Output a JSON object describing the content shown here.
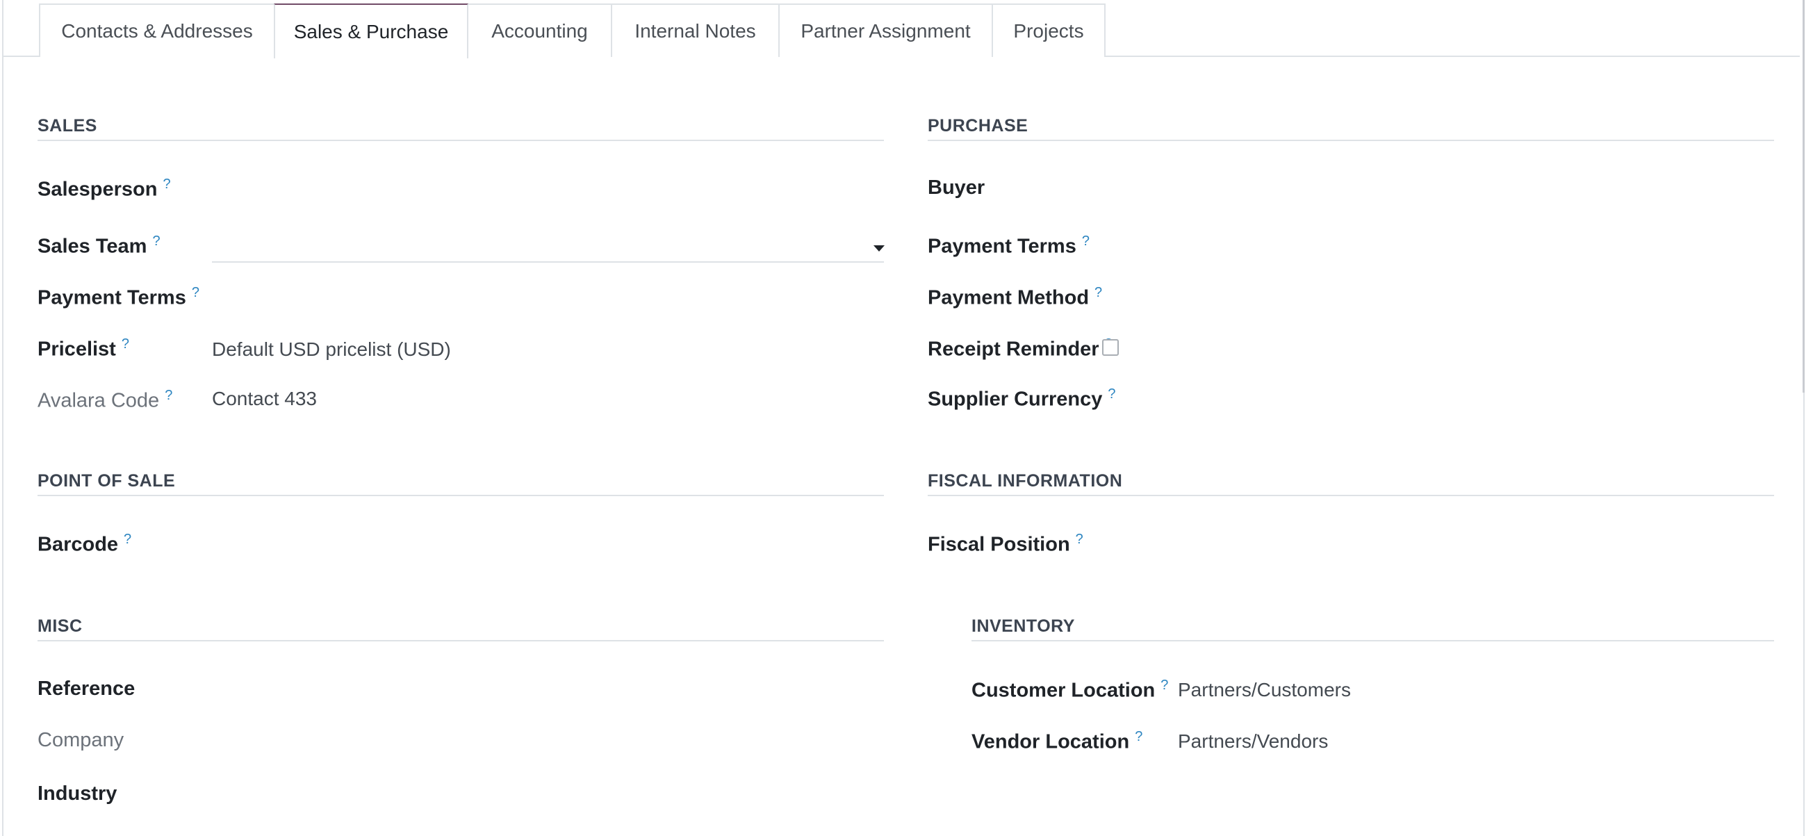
{
  "tabs": [
    {
      "label": "Contacts & Addresses"
    },
    {
      "label": "Sales & Purchase"
    },
    {
      "label": "Accounting"
    },
    {
      "label": "Internal Notes"
    },
    {
      "label": "Partner Assignment"
    },
    {
      "label": "Projects"
    }
  ],
  "active_tab": "Sales & Purchase",
  "help_mark": "?",
  "sales": {
    "title": "SALES",
    "salesperson_label": "Salesperson",
    "sales_team_label": "Sales Team",
    "sales_team_value": "",
    "payment_terms_label": "Payment Terms",
    "pricelist_label": "Pricelist",
    "pricelist_value": "Default USD pricelist (USD)",
    "avalara_label": "Avalara Code",
    "avalara_value": "Contact 433"
  },
  "purchase": {
    "title": "PURCHASE",
    "buyer_label": "Buyer",
    "payment_terms_label": "Payment Terms",
    "payment_method_label": "Payment Method",
    "receipt_reminder_label": "Receipt Reminder",
    "receipt_reminder_checked": false,
    "supplier_currency_label": "Supplier Currency"
  },
  "pos": {
    "title": "POINT OF SALE",
    "barcode_label": "Barcode"
  },
  "fiscal": {
    "title": "FISCAL INFORMATION",
    "fiscal_position_label": "Fiscal Position"
  },
  "misc": {
    "title": "MISC",
    "reference_label": "Reference",
    "company_label": "Company",
    "industry_label": "Industry"
  },
  "inventory": {
    "title": "INVENTORY",
    "customer_location_label": "Customer Location",
    "customer_location_value": "Partners/Customers",
    "vendor_location_label": "Vendor Location",
    "vendor_location_value": "Partners/Vendors"
  },
  "colors": {
    "active_tab_accent": "#714b67",
    "help_mark": "#2e86c1",
    "rule": "#dee2e6"
  }
}
